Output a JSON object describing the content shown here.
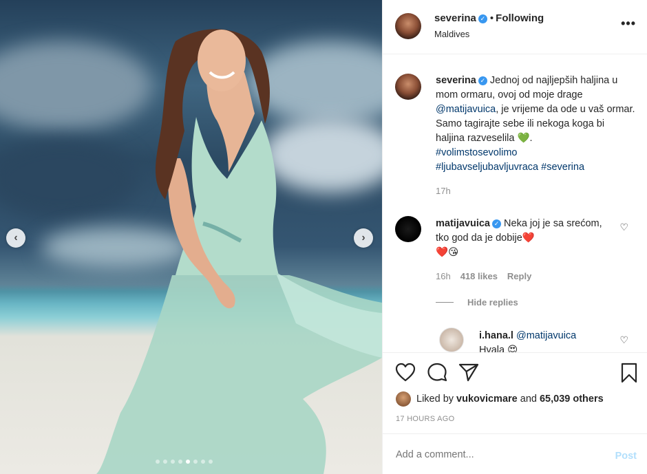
{
  "post": {
    "username": "severina",
    "follow_state": "Following",
    "location": "Maldives",
    "more_icon": "more-options-icon"
  },
  "carousel": {
    "prev_icon": "chevron-left-icon",
    "next_icon": "chevron-right-icon",
    "slide_count": 8,
    "active_index": 4
  },
  "caption": {
    "username": "severina",
    "text_1": "Jednoj od najljepših haljina u mom ormaru, ovoj od moje drage",
    "mention": "@matijavuica",
    "text_2": ", je vrijeme da ode u vaš ormar. Samo tagirajte sebe ili nekoga koga bi haljina razveselila",
    "emoji": "💚",
    "text_3": ".",
    "hashtag_1": "#volimstosevolimo",
    "hashtag_2": "#ljubavseljubavljuvraca",
    "hashtag_3": "#severina",
    "time": "17h"
  },
  "comment": {
    "username": "matijavuica",
    "text": "Neka joj je sa srećom, tko god da je dobije",
    "emoji_1": "❤️",
    "emoji_2": "❤️",
    "emoji_3": "😘",
    "time": "16h",
    "likes": "418 likes",
    "reply": "Reply",
    "hide_replies": "Hide replies"
  },
  "reply": {
    "username": "i.hana.l",
    "mention": "@matijavuica",
    "text": "Hvala",
    "emoji": "😍"
  },
  "actions": {
    "liked_prefix": "Liked by",
    "liked_user": "vukovicmare",
    "liked_and": "and",
    "liked_others": "65,039 others",
    "time_ago": "17 HOURS AGO"
  },
  "add_comment": {
    "placeholder": "Add a comment...",
    "post_label": "Post"
  },
  "colors": {
    "verified": "#3897f0",
    "link": "#00376b",
    "muted": "#8e8e8e",
    "post_disabled": "#b2dffc"
  }
}
